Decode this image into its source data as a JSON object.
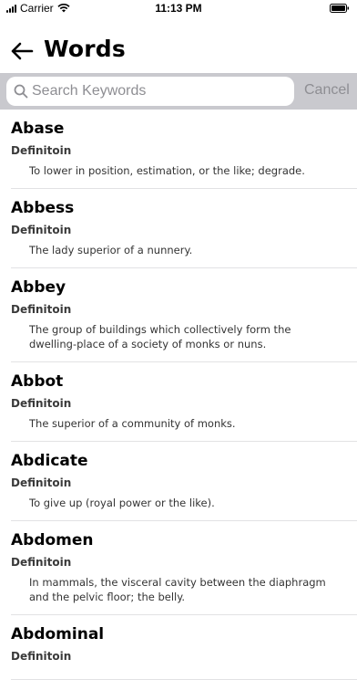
{
  "status_bar": {
    "carrier": "Carrier",
    "time": "11:13 PM"
  },
  "header": {
    "title": "Words",
    "back_icon": "arrow-left-icon"
  },
  "search": {
    "placeholder": "Search Keywords",
    "value": "",
    "cancel_label": "Cancel",
    "icon": "search-icon"
  },
  "words": [
    {
      "word": "Abase",
      "label": "Definitoin",
      "definition": "To lower in position, estimation, or the like; degrade."
    },
    {
      "word": "Abbess",
      "label": "Definitoin",
      "definition": "The lady superior of a nunnery."
    },
    {
      "word": "Abbey",
      "label": "Definitoin",
      "definition": "The group of buildings which collectively form the dwelling-place of a society of monks or nuns."
    },
    {
      "word": "Abbot",
      "label": "Definitoin",
      "definition": "The superior of a community of monks."
    },
    {
      "word": "Abdicate",
      "label": "Definitoin",
      "definition": "To give up (royal power or the like)."
    },
    {
      "word": "Abdomen",
      "label": "Definitoin",
      "definition": "In mammals, the visceral cavity between the diaphragm and the pelvic floor; the belly."
    },
    {
      "word": "Abdominal",
      "label": "Definitoin",
      "definition": ""
    }
  ]
}
